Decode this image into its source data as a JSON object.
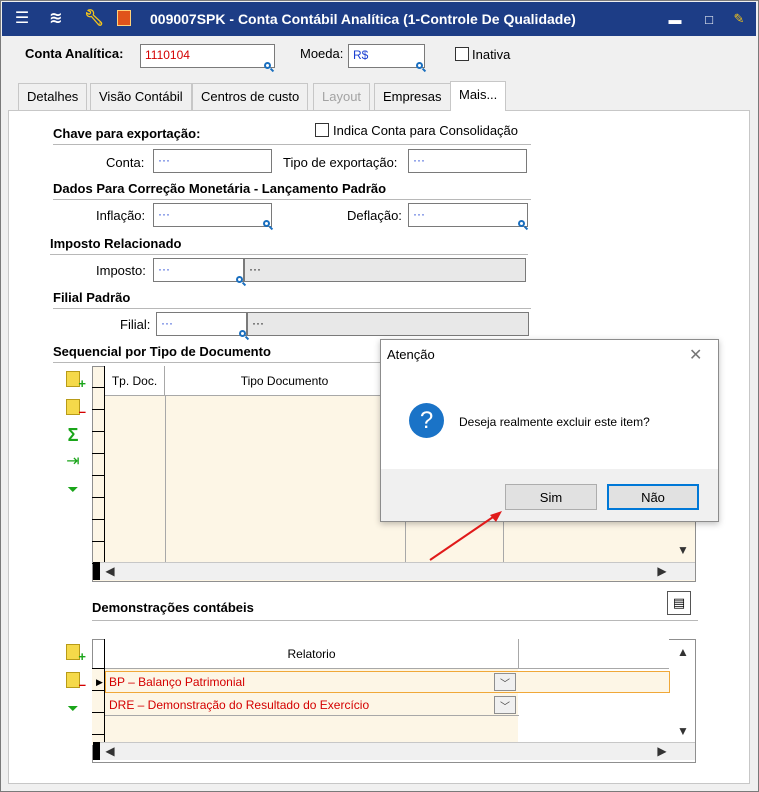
{
  "window": {
    "title": "009007SPK - Conta Contábil Analítica (1-Controle De Qualidade)",
    "colors": {
      "titlebar": "#1d3d86",
      "accent": "#0078d7",
      "error_text": "#d40000",
      "link_text": "#1a3fd1"
    }
  },
  "header": {
    "conta_label": "Conta Analítica:",
    "conta_value": "1110104",
    "moeda_label": "Moeda:",
    "moeda_value": "R$",
    "inativa_label": "Inativa"
  },
  "tabs": [
    {
      "label": "Detalhes"
    },
    {
      "label": "Visão Contábil"
    },
    {
      "label": "Centros de custo"
    },
    {
      "label": "Layout"
    },
    {
      "label": "Empresas"
    },
    {
      "label": "Mais..."
    }
  ],
  "export": {
    "heading": "Chave para exportação:",
    "consolidacao_label": "Indica Conta para Consolidação",
    "conta_label": "Conta:",
    "conta_value": "···",
    "tipo_label": "Tipo de exportação:",
    "tipo_value": "···"
  },
  "correcao": {
    "heading": "Dados Para Correção Monetária - Lançamento Padrão",
    "inflacao_label": "Inflação:",
    "inflacao_value": "···",
    "deflacao_label": "Deflação:",
    "deflacao_value": "···"
  },
  "imposto": {
    "heading": "Imposto Relacionado",
    "label": "Imposto:",
    "code": "···",
    "desc": "···"
  },
  "filial": {
    "heading": "Filial Padrão",
    "label": "Filial:",
    "code": "···",
    "desc": "···"
  },
  "sequencial": {
    "heading": "Sequencial por Tipo de Documento",
    "columns": [
      "Tp. Doc.",
      "Tipo Documento"
    ]
  },
  "demonstracoes": {
    "heading": "Demonstrações contábeis",
    "column": "Relatorio",
    "rows": [
      "BP – Balanço Patrimonial",
      "DRE – Demonstração do Resultado do Exercício"
    ]
  },
  "dialog": {
    "title": "Atenção",
    "message": "Deseja realmente excluir este item?",
    "yes_label": "Sim",
    "no_label": "Não"
  }
}
